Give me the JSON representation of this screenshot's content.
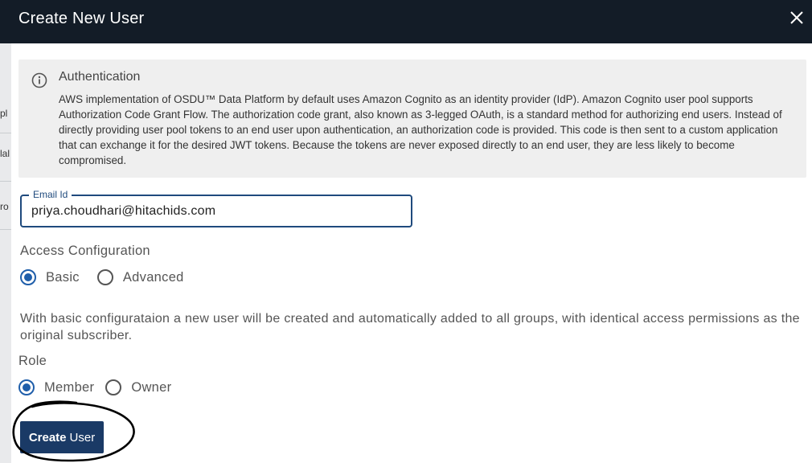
{
  "dialog": {
    "title": "Create New User",
    "close_icon": "close-icon"
  },
  "background_fragments": [
    "pl",
    "lal",
    "ro"
  ],
  "info": {
    "icon": "info-icon",
    "title": "Authentication",
    "body": "AWS implementation of OSDU™ Data Platform by default uses Amazon Cognito as an identity provider (IdP). Amazon Cognito user pool supports Authorization Code Grant Flow. The authorization code grant, also known as 3-legged OAuth, is a standard method for authorizing end users. Instead of directly providing user pool tokens to an end user upon authentication, an authorization code is provided. This code is then sent to a custom application that can exchange it for the desired JWT tokens. Because the tokens are never exposed directly to an end user, they are less likely to become compromised."
  },
  "email": {
    "label": "Email Id",
    "value": "priya.choudhari@hitachids.com"
  },
  "access_configuration": {
    "label": "Access Configuration",
    "options": [
      {
        "label": "Basic",
        "selected": true
      },
      {
        "label": "Advanced",
        "selected": false
      }
    ],
    "description": "With basic configurataion a new user will be created and automatically added to all groups, with identical access permissions as the original subscriber."
  },
  "role": {
    "label": "Role",
    "options": [
      {
        "label": "Member",
        "selected": true
      },
      {
        "label": "Owner",
        "selected": false
      }
    ]
  },
  "create_button": {
    "bold_part": "Create",
    "rest": "User"
  },
  "colors": {
    "titlebar": "#131c27",
    "accent": "#1f5eaa",
    "button": "#1a3a66"
  }
}
